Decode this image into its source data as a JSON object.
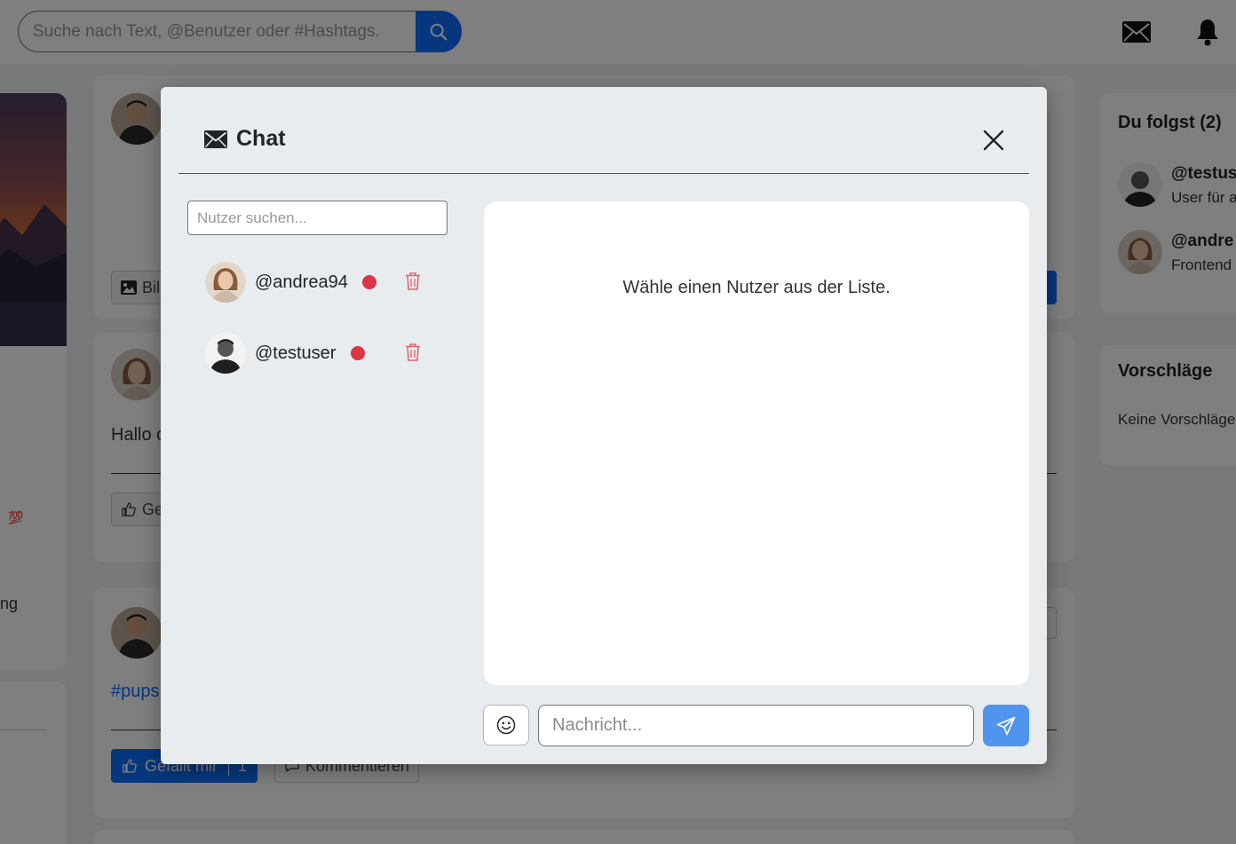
{
  "header": {
    "search_placeholder": "Suche nach Text, @Benutzer oder #Hashtags."
  },
  "background": {
    "left_text": "ng",
    "left_badge": "💯",
    "posts": [
      {
        "button_label": "Bil"
      },
      {
        "text": "Hallo c",
        "like_label": "Ge"
      },
      {
        "hashtag": "#pups",
        "like_label": "Gefällt mir",
        "like_count": "1",
        "comment_label": "Kommentieren"
      }
    ],
    "following": {
      "title": "Du folgst (2)",
      "items": [
        {
          "name": "@testus",
          "desc": "User für a"
        },
        {
          "name": "@andre",
          "desc": "Frontend"
        }
      ]
    },
    "suggestions": {
      "title": "Vorschläge",
      "empty": "Keine Vorschläge"
    }
  },
  "modal": {
    "title": "Chat",
    "user_search_placeholder": "Nutzer suchen...",
    "users": [
      {
        "name": "@andrea94",
        "status_color": "#dc3545"
      },
      {
        "name": "@testuser",
        "status_color": "#dc3545"
      }
    ],
    "empty_state": "Wähle einen Nutzer aus der Liste.",
    "message_placeholder": "Nachricht..."
  }
}
